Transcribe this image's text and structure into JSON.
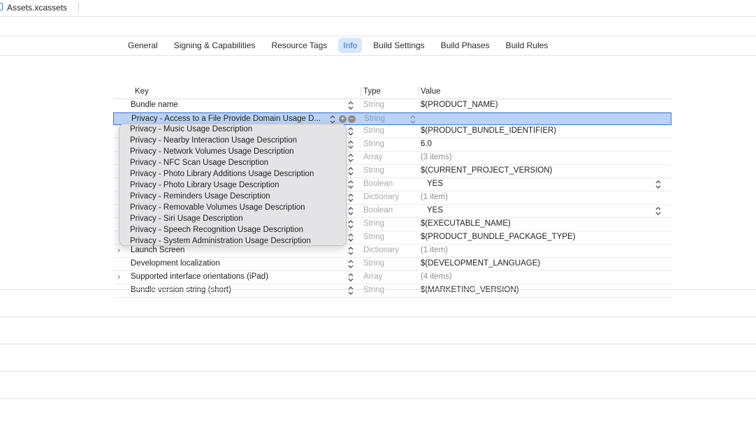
{
  "file": {
    "name": "Assets.xcassets"
  },
  "tabs": [
    {
      "label": "General"
    },
    {
      "label": "Signing & Capabilities"
    },
    {
      "label": "Resource Tags"
    },
    {
      "label": "Info",
      "active": true
    },
    {
      "label": "Build Settings"
    },
    {
      "label": "Build Phases"
    },
    {
      "label": "Build Rules"
    }
  ],
  "table": {
    "headers": {
      "key": "Key",
      "type": "Type",
      "value": "Value"
    },
    "rows": [
      {
        "key": "Bundle name",
        "type": "String",
        "value": "$(PRODUCT_NAME)"
      },
      {
        "key": "Privacy - Access to a File Provide Domain Usage D...",
        "type": "String",
        "value": "",
        "selected": true
      },
      {
        "key": "",
        "type": "String",
        "value": "$(PRODUCT_BUNDLE_IDENTIFIER)"
      },
      {
        "key": "",
        "type": "String",
        "value": "6.0"
      },
      {
        "key": "",
        "type": "Array",
        "value": "(3 items)",
        "muted": true
      },
      {
        "key": "",
        "type": "String",
        "value": "$(CURRENT_PROJECT_VERSION)"
      },
      {
        "key": "",
        "type": "Boolean",
        "value": "YES",
        "bool": true
      },
      {
        "key": "",
        "type": "Dictionary",
        "value": "(1 item)",
        "muted": true
      },
      {
        "key": "",
        "type": "Boolean",
        "value": "YES",
        "bool": true
      },
      {
        "key": "",
        "type": "String",
        "value": "$(EXECUTABLE_NAME)"
      },
      {
        "key": "",
        "type": "String",
        "value": "$(PRODUCT_BUNDLE_PACKAGE_TYPE)"
      },
      {
        "key": "Launch Screen",
        "type": "Dictionary",
        "value": "(1 item)",
        "muted": true,
        "disclosure": true
      },
      {
        "key": "Development localization",
        "type": "String",
        "value": "$(DEVELOPMENT_LANGUAGE)"
      },
      {
        "key": "Supported interface orientations (iPad)",
        "type": "Array",
        "value": "(4 items)",
        "muted": true,
        "disclosure": true
      },
      {
        "key": "Bundle version string (short)",
        "type": "String",
        "value": "$(MARKETING_VERSION)"
      }
    ]
  },
  "dropdown": {
    "options": [
      "Privacy - Music Usage Description",
      "Privacy - Nearby Interaction Usage Description",
      "Privacy - Network Volumes Usage Description",
      "Privacy - NFC Scan Usage Description",
      "Privacy - Photo Library Additions Usage Description",
      "Privacy - Photo Library Usage Description",
      "Privacy - Reminders Usage Description",
      "Privacy - Removable Volumes Usage Description",
      "Privacy - Siri Usage Description",
      "Privacy - Speech Recognition Usage Description",
      "Privacy - System Administration Usage Description"
    ]
  },
  "icons": {
    "add": "plus-circle-icon",
    "remove": "minus-circle-icon",
    "stepper": "up-down-chevron-icon"
  },
  "colors": {
    "accent": "#2f6fd6",
    "selection": "#bcd3f6"
  }
}
